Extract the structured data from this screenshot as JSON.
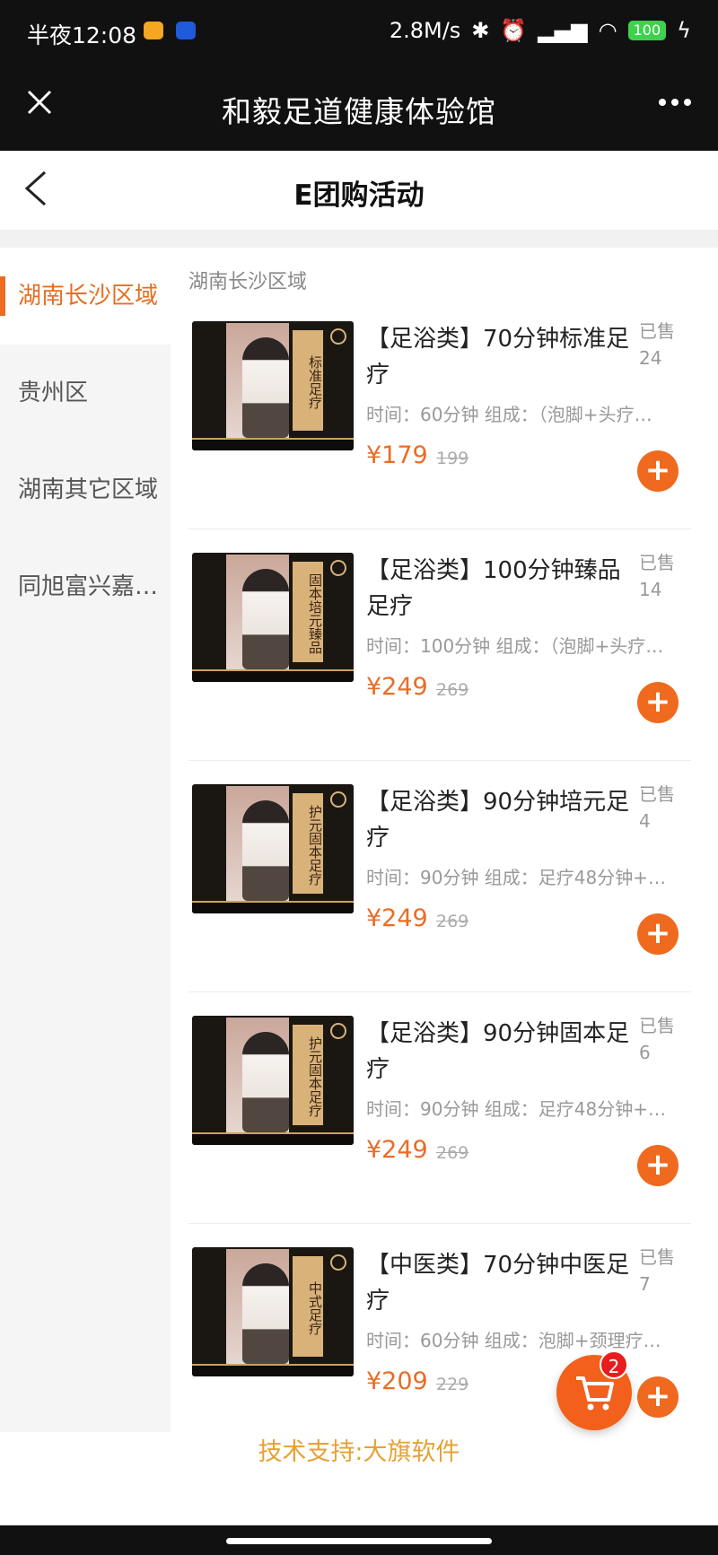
{
  "statusbar": {
    "time": "半夜12:08",
    "network": "2.8M/s",
    "battery": "100",
    "chip_colors": [
      "#f5a623",
      "#1f5ad8"
    ]
  },
  "webview": {
    "title": "和毅足道健康体验馆",
    "close_icon": "close-icon",
    "more_icon": "more-icon"
  },
  "page": {
    "title": "E团购活动"
  },
  "sidebar": {
    "items": [
      {
        "label": "湖南长沙区域",
        "active": true
      },
      {
        "label": "贵州区",
        "active": false
      },
      {
        "label": "湖南其它区域",
        "active": false
      },
      {
        "label": "同旭富兴嘉…",
        "active": false
      }
    ]
  },
  "section": {
    "title": "湖南长沙区域"
  },
  "products": [
    {
      "name": "【足浴类】70分钟标准足疗",
      "sold_label": "已售",
      "sold": "24",
      "desc": "时间：60分钟 组成：（泡脚+头疗…",
      "price": "¥179",
      "old_price": "199",
      "thumb_text": "标准足疗"
    },
    {
      "name": "【足浴类】100分钟臻品足疗",
      "sold_label": "已售",
      "sold": "14",
      "desc": "时间：100分钟 组成：（泡脚+头疗…",
      "price": "¥249",
      "old_price": "269",
      "thumb_text": "固本培元臻品"
    },
    {
      "name": "【足浴类】90分钟培元足疗",
      "sold_label": "已售",
      "sold": "4",
      "desc": "时间：90分钟 组成：足疗48分钟+…",
      "price": "¥249",
      "old_price": "269",
      "thumb_text": "护元固本足疗"
    },
    {
      "name": "【足浴类】90分钟固本足疗",
      "sold_label": "已售",
      "sold": "6",
      "desc": "时间：90分钟 组成：足疗48分钟+…",
      "price": "¥249",
      "old_price": "269",
      "thumb_text": "护元固本足疗"
    },
    {
      "name": "【中医类】70分钟中医足疗",
      "sold_label": "已售",
      "sold": "7",
      "desc": "时间：60分钟 组成：泡脚+颈理疗…",
      "price": "¥209",
      "old_price": "229",
      "thumb_text": "中式足疗"
    }
  ],
  "add_label": "+",
  "cart": {
    "count": "2"
  },
  "footer": {
    "text": "技术支持:大旗软件"
  },
  "colors": {
    "accent": "#ef6a1f",
    "price": "#e86d25",
    "footer": "#e5a234"
  }
}
